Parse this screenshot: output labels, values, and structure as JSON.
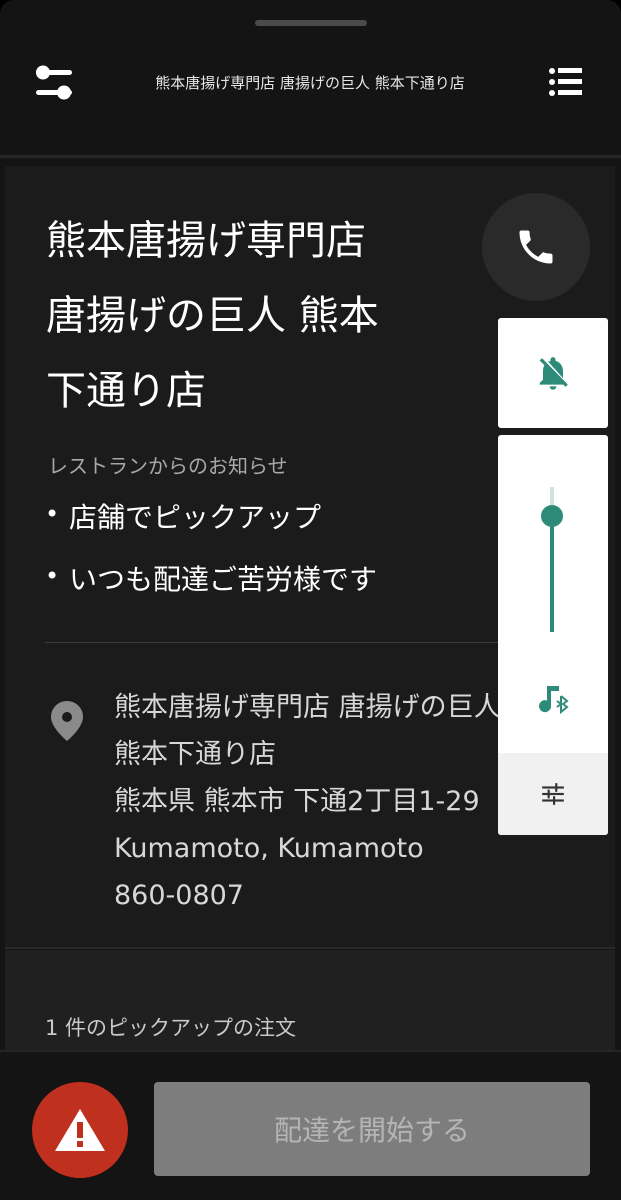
{
  "header": {
    "title": "熊本唐揚げ専門店 唐揚げの巨人 熊本下通り店",
    "left_icon": "filter-icon",
    "right_icon": "list-icon"
  },
  "store": {
    "name_lines": [
      "熊本唐揚げ専門店",
      "唐揚げの巨人 熊本",
      "下通り店"
    ]
  },
  "notice": {
    "heading": "レストランからのお知らせ",
    "items": [
      "店舗でピックアップ",
      "いつも配達ご苦労様です"
    ],
    "bullet": "•"
  },
  "address": {
    "lines": [
      "熊本唐揚げ専門店 唐揚げの巨人",
      "熊本下通り店",
      "熊本県 熊本市 下通2丁目1-29",
      "Kumamoto, Kumamoto",
      "860-0807"
    ]
  },
  "controls": {
    "call_icon": "phone-icon",
    "mute_icon": "bell-off-icon",
    "volume_level": 0.8,
    "bluetooth_icon": "music-bluetooth-icon",
    "settings_icon": "sliders-icon"
  },
  "orders": {
    "summary": "1 件のピックアップの注文"
  },
  "footer": {
    "alert_icon": "warning-icon",
    "start_label": "配達を開始する"
  },
  "colors": {
    "accent": "#2e8b7a",
    "alert": "#c0301e",
    "disabled_button": "#7d7d7d"
  }
}
